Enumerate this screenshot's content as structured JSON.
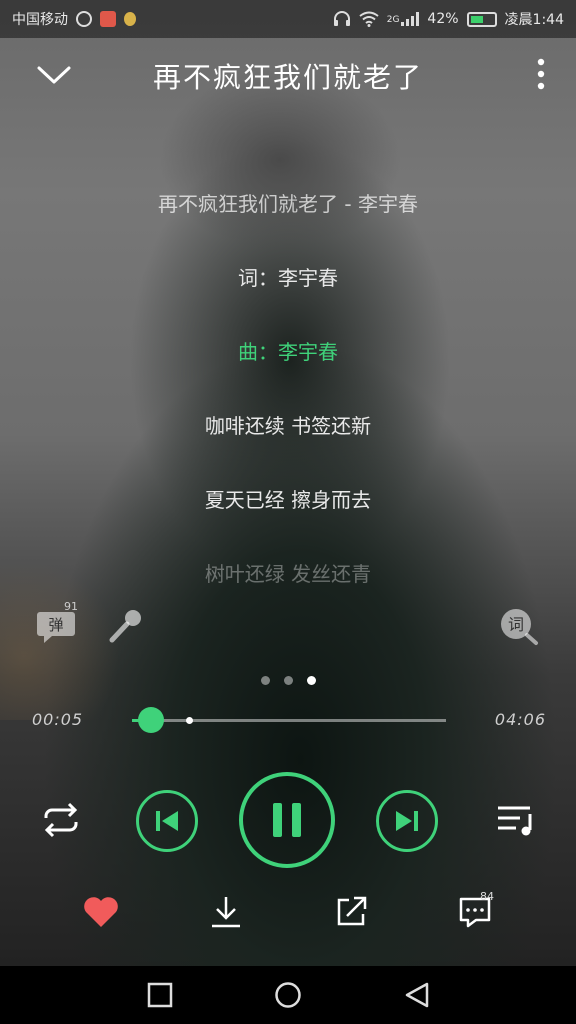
{
  "status_bar": {
    "carrier": "中国移动",
    "network": "2G",
    "battery": "42%",
    "time": "凌晨1:44"
  },
  "header": {
    "title": "再不疯狂我们就老了"
  },
  "lyrics": [
    "再不疯狂我们就老了 - 李宇春",
    "词：李宇春",
    "曲：李宇春",
    "咖啡还续 书签还新",
    "夏天已经 擦身而去",
    "树叶还绿 发丝还青"
  ],
  "current_lyric_index": 2,
  "danmu": {
    "label": "弹",
    "count": "91"
  },
  "lyric_search": {
    "label": "词"
  },
  "pager": {
    "count": 3,
    "active": 2
  },
  "player": {
    "current_time": "00:05",
    "total_time": "04:06",
    "progress": 0.06,
    "buffered": 0.18
  },
  "actions": {
    "comment_count": "84"
  },
  "colors": {
    "accent": "#3fd27a",
    "like": "#f15b5b"
  }
}
